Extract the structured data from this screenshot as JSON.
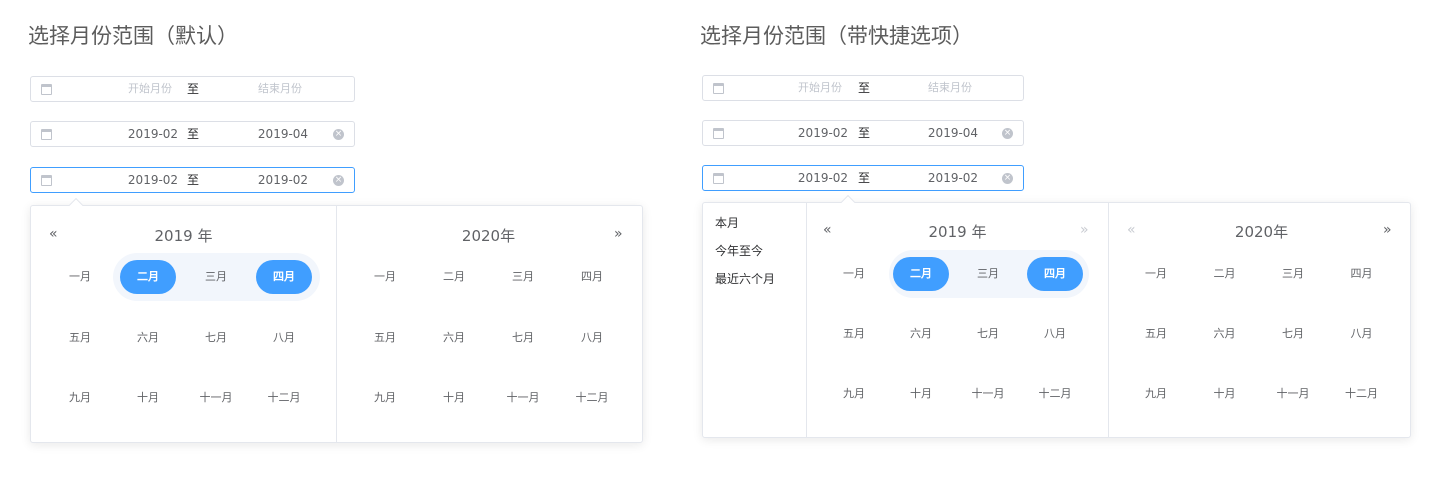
{
  "sections": {
    "default_title": "选择月份范围（默认）",
    "shortcuts_title": "选择月份范围（带快捷选项）"
  },
  "inputs": {
    "start_placeholder": "开始月份",
    "end_placeholder": "结束月份",
    "separator": "至",
    "filled": {
      "start": "2019-02",
      "end": "2019-04"
    },
    "active": {
      "start": "2019-02",
      "end": "2019-02"
    }
  },
  "picker": {
    "left_header": "2019 年",
    "right_header": "2020年",
    "months": [
      "一月",
      "二月",
      "三月",
      "四月",
      "五月",
      "六月",
      "七月",
      "八月",
      "九月",
      "十月",
      "十一月",
      "十二月"
    ],
    "selected_start": "二月",
    "selected_end": "四月",
    "prev_year": "«",
    "next_year": "»"
  },
  "shortcuts": {
    "items": [
      "本月",
      "今年至今",
      "最近六个月"
    ]
  },
  "colors": {
    "accent": "#409eff",
    "range_bg": "#f2f6fc",
    "border": "#dcdfe6"
  },
  "icons": {
    "calendar": "calendar-icon",
    "clear": "circle-close-icon"
  }
}
